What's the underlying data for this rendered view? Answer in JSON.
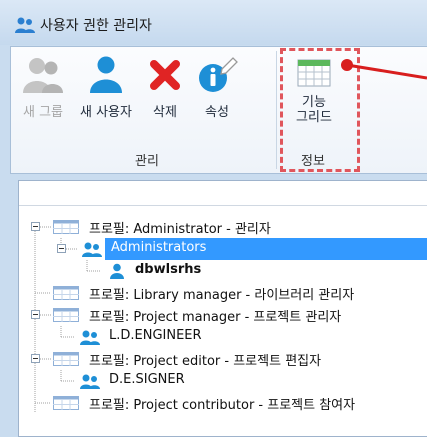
{
  "window": {
    "title": "사용자 권한 관리자"
  },
  "ribbon": {
    "tools": [
      {
        "label": "새 그룹",
        "enabled": false
      },
      {
        "label": "새 사용자",
        "enabled": true
      },
      {
        "label": "삭제",
        "enabled": true
      },
      {
        "label": "속성",
        "enabled": true
      }
    ],
    "group_manage_label": "관리",
    "grid_tool": {
      "label_line1": "기능",
      "label_line2": "그리드",
      "group_label": "정보"
    }
  },
  "tree": {
    "rows": [
      {
        "text": "프로필: Administrator - 관리자",
        "type": "profile"
      },
      {
        "text": "Administrators",
        "type": "group",
        "selected": true
      },
      {
        "text": "dbwlsrhs",
        "type": "user"
      },
      {
        "text": "프로필: Library manager - 라이브러리 관리자",
        "type": "profile"
      },
      {
        "text": "프로필: Project manager - 프로젝트 관리자",
        "type": "profile"
      },
      {
        "text": "L.D.ENGINEER",
        "type": "group"
      },
      {
        "text": "프로필: Project editor - 프로젝트 편집자",
        "type": "profile"
      },
      {
        "text": "D.E.SIGNER",
        "type": "group"
      },
      {
        "text": "프로필: Project contributor - 프로젝트 참여자",
        "type": "profile"
      }
    ]
  },
  "colors": {
    "accent": "#3399ff",
    "highlight": "#e0565c",
    "delete": "#e02424",
    "user": "#1e8fd6"
  }
}
